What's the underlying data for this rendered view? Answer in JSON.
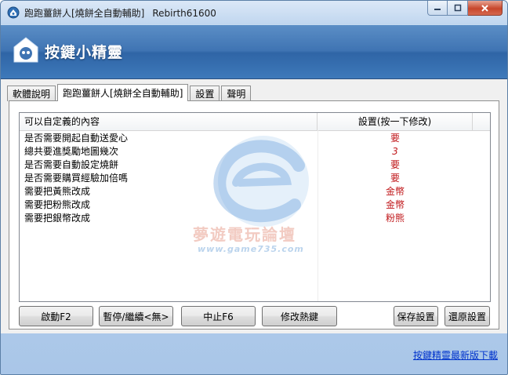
{
  "window": {
    "title": "跑跑薑餅人[燒餅全自動輔助]",
    "version": "Rebirth61600"
  },
  "banner": {
    "title": "按鍵小精靈"
  },
  "tabs": [
    {
      "label": "軟體說明"
    },
    {
      "label": "跑跑薑餅人[燒餅全自動輔助]"
    },
    {
      "label": "設置"
    },
    {
      "label": "聲明"
    }
  ],
  "list": {
    "headers": {
      "name": "可以自定義的內容",
      "value": "設置(按一下修改)"
    },
    "rows": [
      {
        "name": "是否需要開起自動送愛心",
        "value": "要"
      },
      {
        "name": "總共要進獎勵地圖幾次",
        "value": "3"
      },
      {
        "name": "是否需要自動設定燒餅",
        "value": "要"
      },
      {
        "name": "是否需要購買經驗加倍嗎",
        "value": "要"
      },
      {
        "name": "需要把黃熊改成",
        "value": "金幣"
      },
      {
        "name": "需要把粉熊改成",
        "value": "金幣"
      },
      {
        "name": "需要把銀幣改成",
        "value": "粉熊"
      }
    ]
  },
  "watermark": {
    "line1": "夢遊電玩論壇",
    "line2": "www.game735.com"
  },
  "buttons": {
    "start": "啟動F2",
    "pause": "暫停/繼續<無>",
    "stop": "中止F6",
    "hotkey": "修改熱鍵",
    "save": "保存設置",
    "restore": "還原設置"
  },
  "footer": {
    "link": "按鍵精靈最新版下載"
  },
  "colors": {
    "value_text": "#c0181b",
    "banner": "#3f74b3",
    "link": "#0033cc"
  }
}
